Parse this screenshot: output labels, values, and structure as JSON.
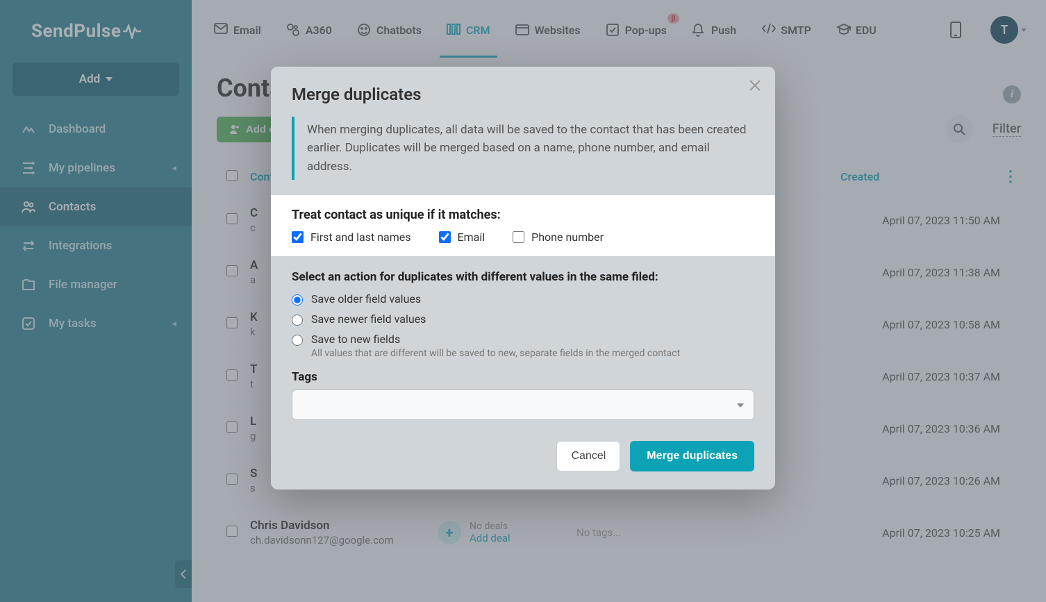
{
  "brand": "SendPulse",
  "sidebar": {
    "add_label": "Add",
    "items": [
      {
        "label": "Dashboard"
      },
      {
        "label": "My pipelines",
        "chev": true
      },
      {
        "label": "Contacts",
        "active": true
      },
      {
        "label": "Integrations"
      },
      {
        "label": "File manager"
      },
      {
        "label": "My tasks",
        "chev": true
      }
    ]
  },
  "topnav": {
    "items": [
      {
        "label": "Email"
      },
      {
        "label": "A360"
      },
      {
        "label": "Chatbots"
      },
      {
        "label": "CRM",
        "active": true
      },
      {
        "label": "Websites"
      },
      {
        "label": "Pop-ups",
        "beta": "β"
      },
      {
        "label": "Push"
      },
      {
        "label": "SMTP"
      },
      {
        "label": "EDU"
      }
    ],
    "avatar": "T"
  },
  "page": {
    "title": "Contacts",
    "add_contact": "Add contact",
    "merge_dupes_btn": "Merge duplicates",
    "filter": "Filter",
    "col_contact": "Contact",
    "col_created": "Created"
  },
  "rows": [
    {
      "name": "C",
      "email": "c",
      "date": "April 07, 2023 11:50 AM"
    },
    {
      "name": "A",
      "email": "a",
      "date": "April 07, 2023 11:38 AM"
    },
    {
      "name": "K",
      "email": "k",
      "date": "April 07, 2023 10:58 AM"
    },
    {
      "name": "T",
      "email": "t",
      "date": "April 07, 2023 10:37 AM"
    },
    {
      "name": "L",
      "email": "g",
      "date": "April 07, 2023 10:36 AM"
    },
    {
      "name": "S",
      "email": "s",
      "date": "April 07, 2023 10:26 AM"
    },
    {
      "name": "Chris Davidson",
      "email": "ch.davidsonn127@google.com",
      "date": "April 07, 2023 10:25 AM",
      "deals": true
    }
  ],
  "deals": {
    "no_deals": "No deals",
    "add_deal": "Add deal",
    "no_tags": "No tags..."
  },
  "modal": {
    "title": "Merge duplicates",
    "callout": "When merging duplicates, all data will be saved to the contact that has been created earlier. Duplicates will be merged based on a name, phone number, and email address.",
    "unique_head": "Treat contact as unique if it matches:",
    "chk_names": "First and last names",
    "chk_email": "Email",
    "chk_phone": "Phone number",
    "action_head": "Select an action for duplicates with different values in the same filed:",
    "r_older": "Save older field values",
    "r_newer": "Save newer field values",
    "r_new": "Save to new fields",
    "r_new_hint": "All values that are different will be saved to new, separate fields in the merged contact",
    "tags_label": "Tags",
    "cancel": "Cancel",
    "submit": "Merge duplicates"
  }
}
